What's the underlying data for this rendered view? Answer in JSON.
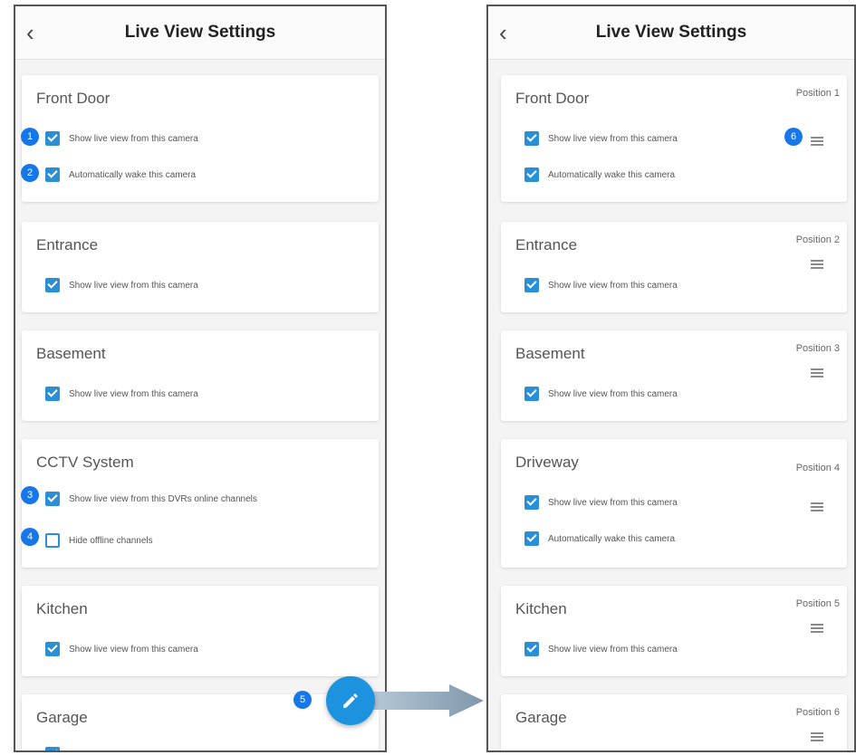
{
  "colors": {
    "accent": "#2b8fd6",
    "badge": "#1877e8",
    "fab": "#1d93e0"
  },
  "left_screen": {
    "back_icon": "‹",
    "title": "Live View Settings",
    "cards": [
      {
        "name": "Front Door",
        "options": [
          {
            "label": "Show live view from this camera",
            "checked": true,
            "badge": "1"
          },
          {
            "label": "Automatically wake this camera",
            "checked": true,
            "badge": "2"
          }
        ]
      },
      {
        "name": "Entrance",
        "options": [
          {
            "label": "Show live view from this camera",
            "checked": true
          }
        ]
      },
      {
        "name": "Basement",
        "options": [
          {
            "label": "Show live view from this camera",
            "checked": true
          }
        ]
      },
      {
        "name": "CCTV System",
        "options": [
          {
            "label": "Show live view from this DVRs online channels",
            "checked": true,
            "badge": "3"
          },
          {
            "label": "Hide offline channels",
            "checked": false,
            "badge": "4"
          }
        ]
      },
      {
        "name": "Kitchen",
        "options": [
          {
            "label": "Show live view from this camera",
            "checked": true
          }
        ]
      },
      {
        "name": "Garage",
        "options": []
      }
    ],
    "fab_icon": "pencil-icon",
    "fab_badge": "5"
  },
  "right_screen": {
    "back_icon": "‹",
    "title": "Live View Settings",
    "cards": [
      {
        "name": "Front Door",
        "position": "Position 1",
        "handle_badge": "6",
        "options": [
          {
            "label": "Show live view from this camera",
            "checked": true
          },
          {
            "label": "Automatically wake this camera",
            "checked": true
          }
        ]
      },
      {
        "name": "Entrance",
        "position": "Position 2",
        "options": [
          {
            "label": "Show live view from this camera",
            "checked": true
          }
        ]
      },
      {
        "name": "Basement",
        "position": "Position 3",
        "options": [
          {
            "label": "Show live view from this camera",
            "checked": true
          }
        ]
      },
      {
        "name": "Driveway",
        "position": "Position 4",
        "options": [
          {
            "label": "Show live view from this camera",
            "checked": true
          },
          {
            "label": "Automatically wake this camera",
            "checked": true
          }
        ]
      },
      {
        "name": "Kitchen",
        "position": "Position 5",
        "options": [
          {
            "label": "Show live view from this camera",
            "checked": true
          }
        ]
      },
      {
        "name": "Garage",
        "position": "Position 6",
        "options": []
      }
    ]
  }
}
